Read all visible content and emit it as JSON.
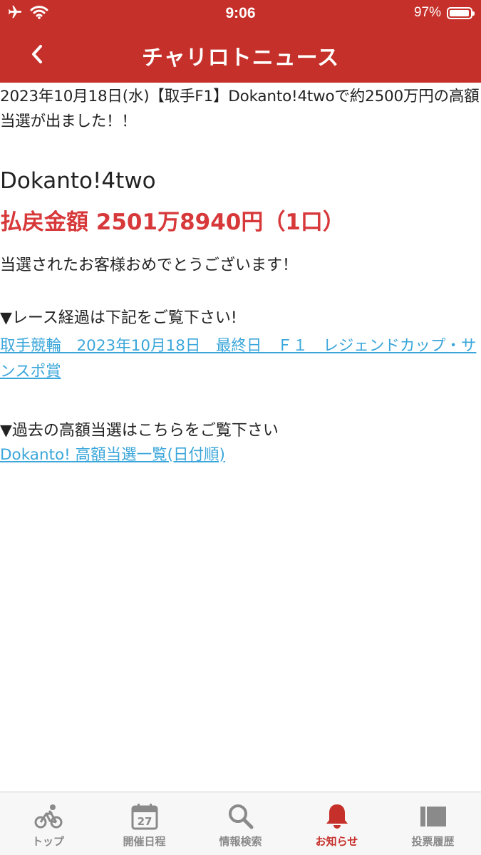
{
  "status_bar": {
    "time": "9:06",
    "battery_text": "97%",
    "battery_level": 0.97
  },
  "header": {
    "title": "チャリロトニュース"
  },
  "article": {
    "title": "2023年10月18日(水)【取手F1】Dokanto!4twoで約2500万円の高額当選が出ました！！",
    "game_name": "Dokanto!4two",
    "payout": "払戻金額 2501万8940円（1口）",
    "congrats": "当選されたお客様おめでとうございます！",
    "race_heading": "▼レース経過は下記をご覧下さい!",
    "race_link": "取手競輪　2023年10月18日　最終日　Ｆ１　レジェンドカップ・サンスポ賞",
    "past_heading": "▼過去の高額当選はこちらをご覧下さい",
    "past_link": "Dokanto! 高額当選一覧(日付順)"
  },
  "tabs": [
    {
      "label": "トップ",
      "icon": "bicycle-icon",
      "active": false
    },
    {
      "label": "開催日程",
      "icon": "calendar-icon",
      "calendar_day": "27",
      "active": false
    },
    {
      "label": "情報検索",
      "icon": "search-icon",
      "active": false
    },
    {
      "label": "お知らせ",
      "icon": "bell-icon",
      "active": true
    },
    {
      "label": "投票履歴",
      "icon": "history-icon",
      "active": false
    }
  ],
  "colors": {
    "brand_red": "#c6302a",
    "payout_red": "#d7383a",
    "link_blue": "#3aa6da",
    "inactive_gray": "#8a8a8a"
  }
}
